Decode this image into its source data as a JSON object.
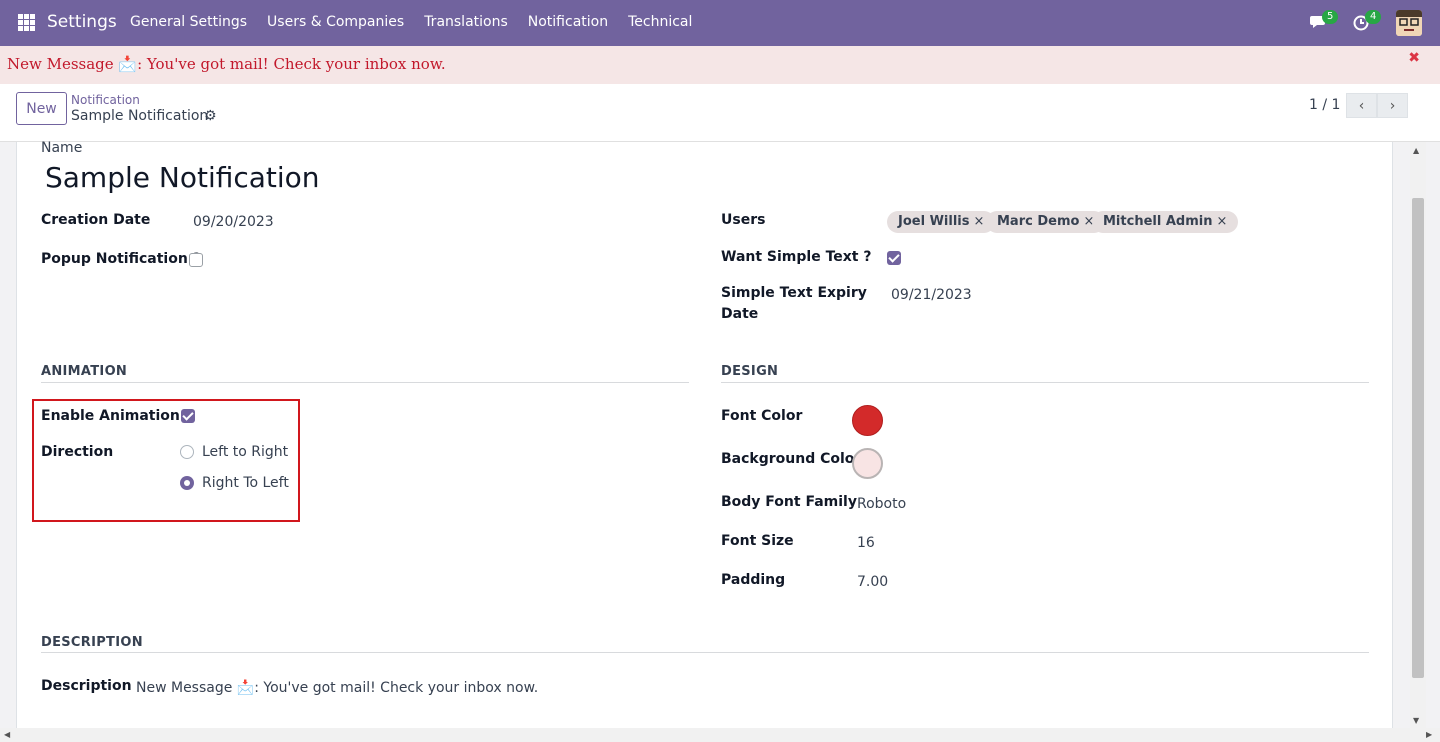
{
  "topbar": {
    "brand": "Settings",
    "menu": [
      "General Settings",
      "Users & Companies",
      "Translations",
      "Notification",
      "Technical"
    ],
    "chat_badge": "5",
    "activity_badge": "4"
  },
  "notification_banner": {
    "text": "New Message 📩: You've got mail! Check your inbox now."
  },
  "control_panel": {
    "new_label": "New",
    "breadcrumb_parent": "Notification",
    "breadcrumb_current": "Sample Notification",
    "pager": "1 / 1"
  },
  "form": {
    "name_label": "Name",
    "name_value": "Sample Notification",
    "creation_date_label": "Creation Date",
    "creation_date_value": "09/20/2023",
    "popup_label": "Popup Notification ?",
    "users_label": "Users",
    "users": [
      "Joel Willis",
      "Marc Demo",
      "Mitchell Admin"
    ],
    "want_simple_text_label": "Want Simple Text ?",
    "simple_text_expiry_label_1": "Simple Text Expiry",
    "simple_text_expiry_label_2": "Date",
    "simple_text_expiry_value": "09/21/2023",
    "animation_section": "ANIMATION",
    "enable_animation_label": "Enable Animation ?",
    "direction_label": "Direction",
    "direction_options": [
      "Left to Right",
      "Right To Left"
    ],
    "design_section": "DESIGN",
    "font_color_label": "Font Color",
    "font_color": "#d32a2a",
    "background_color_label": "Background Color",
    "background_color": "#f8e4e4",
    "body_font_family_label": "Body Font Family",
    "body_font_family_value": "Roboto",
    "font_size_label": "Font Size",
    "font_size_value": "16",
    "padding_label": "Padding",
    "padding_value": "7.00",
    "description_section": "DESCRIPTION",
    "description_label": "Description",
    "description_value": "New Message 📩: You've got mail! Check your inbox now."
  },
  "colors": {
    "accent": "#71639e",
    "highlight_box": "#d1171d"
  }
}
